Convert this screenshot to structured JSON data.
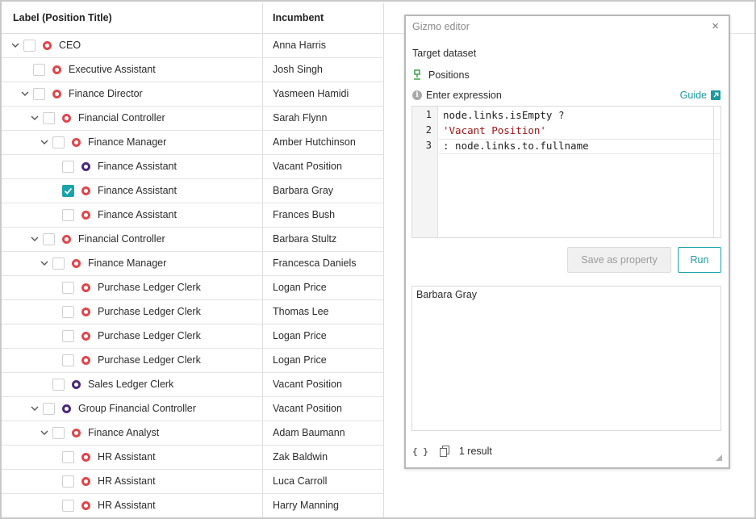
{
  "table": {
    "headers": {
      "label": "Label (Position Title)",
      "incumbent": "Incumbent"
    },
    "rows": [
      {
        "level": 0,
        "chevron": true,
        "checked": false,
        "node_color": "red",
        "label": "CEO",
        "incumbent": "Anna Harris"
      },
      {
        "level": 1,
        "chevron": false,
        "checked": false,
        "node_color": "red",
        "label": "Executive Assistant",
        "incumbent": "Josh Singh"
      },
      {
        "level": 1,
        "chevron": true,
        "checked": false,
        "node_color": "red",
        "label": "Finance Director",
        "incumbent": "Yasmeen Hamidi"
      },
      {
        "level": 2,
        "chevron": true,
        "checked": false,
        "node_color": "red",
        "label": "Financial Controller",
        "incumbent": "Sarah Flynn"
      },
      {
        "level": 3,
        "chevron": true,
        "checked": false,
        "node_color": "red",
        "label": "Finance Manager",
        "incumbent": "Amber Hutchinson"
      },
      {
        "level": 4,
        "chevron": false,
        "checked": false,
        "node_color": "purple",
        "label": "Finance Assistant",
        "incumbent": "Vacant Position"
      },
      {
        "level": 4,
        "chevron": false,
        "checked": true,
        "node_color": "red",
        "label": "Finance Assistant",
        "incumbent": "Barbara Gray"
      },
      {
        "level": 4,
        "chevron": false,
        "checked": false,
        "node_color": "red",
        "label": "Finance Assistant",
        "incumbent": "Frances Bush"
      },
      {
        "level": 2,
        "chevron": true,
        "checked": false,
        "node_color": "red",
        "label": "Financial Controller",
        "incumbent": "Barbara Stultz"
      },
      {
        "level": 3,
        "chevron": true,
        "checked": false,
        "node_color": "red",
        "label": "Finance Manager",
        "incumbent": "Francesca Daniels"
      },
      {
        "level": 4,
        "chevron": false,
        "checked": false,
        "node_color": "red",
        "label": "Purchase Ledger Clerk",
        "incumbent": "Logan Price"
      },
      {
        "level": 4,
        "chevron": false,
        "checked": false,
        "node_color": "red",
        "label": "Purchase Ledger Clerk",
        "incumbent": "Thomas Lee"
      },
      {
        "level": 4,
        "chevron": false,
        "checked": false,
        "node_color": "red",
        "label": "Purchase Ledger Clerk",
        "incumbent": "Logan Price"
      },
      {
        "level": 4,
        "chevron": false,
        "checked": false,
        "node_color": "red",
        "label": "Purchase Ledger Clerk",
        "incumbent": "Logan Price"
      },
      {
        "level": 3,
        "chevron": false,
        "checked": false,
        "node_color": "purple",
        "label": "Sales Ledger Clerk",
        "incumbent": "Vacant Position"
      },
      {
        "level": 2,
        "chevron": true,
        "checked": false,
        "node_color": "purple",
        "label": "Group Financial Controller",
        "incumbent": "Vacant Position"
      },
      {
        "level": 3,
        "chevron": true,
        "checked": false,
        "node_color": "red",
        "label": "Finance Analyst",
        "incumbent": "Adam Baumann"
      },
      {
        "level": 4,
        "chevron": false,
        "checked": false,
        "node_color": "red",
        "label": "HR Assistant",
        "incumbent": "Zak Baldwin"
      },
      {
        "level": 4,
        "chevron": false,
        "checked": false,
        "node_color": "red",
        "label": "HR Assistant",
        "incumbent": "Luca Carroll"
      },
      {
        "level": 4,
        "chevron": false,
        "checked": false,
        "node_color": "red",
        "label": "HR Assistant",
        "incumbent": "Harry Manning"
      }
    ]
  },
  "gizmo": {
    "title": "Gizmo editor",
    "close_icon": "close-icon",
    "target_label": "Target dataset",
    "dataset_name": "Positions",
    "dataset_icon": "org-node-icon",
    "expression_label": "Enter expression",
    "guide_label": "Guide",
    "code_lines": [
      {
        "number": "1",
        "text": "node.links.isEmpty ?",
        "kind": "plain"
      },
      {
        "number": "2",
        "text": "'Vacant Position'",
        "kind": "string"
      },
      {
        "number": "3",
        "text": ": node.links.to.fullname",
        "kind": "plain"
      }
    ],
    "save_label": "Save as property",
    "run_label": "Run",
    "result_text": "Barbara Gray",
    "result_count": "1 result"
  },
  "colors": {
    "accent": "#1aa3ad",
    "node_red": "#e0474c",
    "node_purple": "#4b2a7a",
    "code_string": "#a31515",
    "dataset_icon": "#3aa34a"
  }
}
